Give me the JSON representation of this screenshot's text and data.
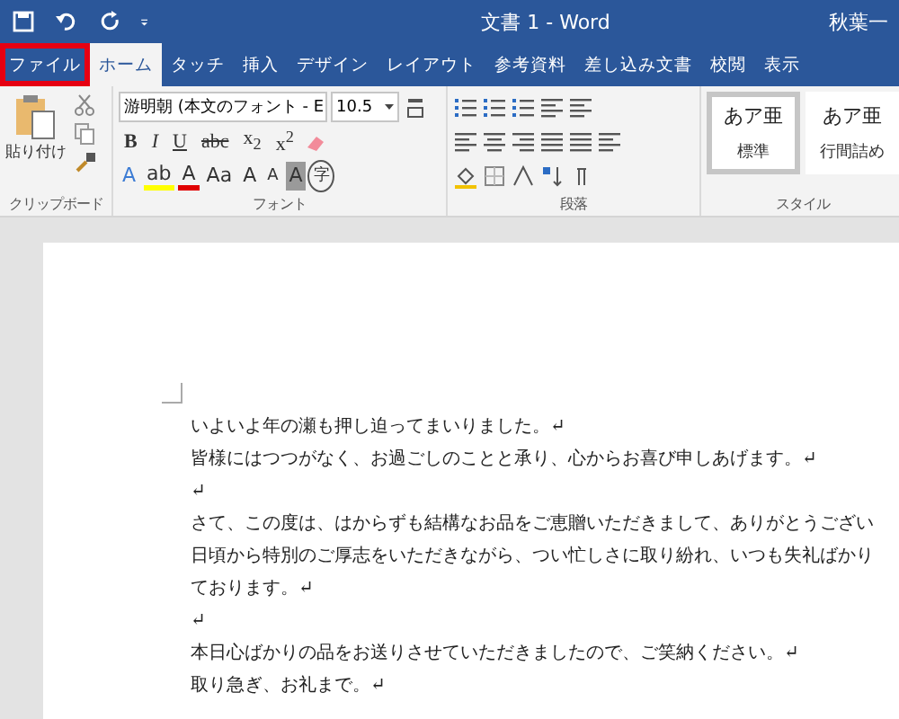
{
  "title_bar": {
    "title": "文書 1 - Word",
    "user": "秋葉一"
  },
  "tabs": [
    {
      "label": "ファイル",
      "selected": false,
      "highlighted": true
    },
    {
      "label": "ホーム",
      "selected": true,
      "highlighted": false
    },
    {
      "label": "タッチ",
      "selected": false,
      "highlighted": false
    },
    {
      "label": "挿入",
      "selected": false,
      "highlighted": false
    },
    {
      "label": "デザイン",
      "selected": false,
      "highlighted": false
    },
    {
      "label": "レイアウト",
      "selected": false,
      "highlighted": false
    },
    {
      "label": "参考資料",
      "selected": false,
      "highlighted": false
    },
    {
      "label": "差し込み文書",
      "selected": false,
      "highlighted": false
    },
    {
      "label": "校閲",
      "selected": false,
      "highlighted": false
    },
    {
      "label": "表示",
      "selected": false,
      "highlighted": false
    }
  ],
  "clipboard": {
    "paste_label": "貼り付け",
    "group_label": "クリップボード"
  },
  "font": {
    "font_name": "游明朝 (本文のフォント - E",
    "font_size": "10.5",
    "group_label": "フォント",
    "format_buttons": [
      {
        "label": "B",
        "kind": "bold"
      },
      {
        "label": "I",
        "kind": "italic"
      },
      {
        "label": "U",
        "kind": "underline"
      },
      {
        "label": "abc",
        "kind": "strike"
      },
      {
        "label": "x$_{2}$",
        "kind": "plain"
      },
      {
        "label": "x$^{2}$",
        "kind": "plain"
      }
    ],
    "effect_buttons": [
      {
        "label": "A",
        "kind": "outline"
      },
      {
        "label": "ab",
        "kind": "highlight"
      },
      {
        "label": "A",
        "kind": "fontcolor"
      },
      {
        "label": "Aa",
        "kind": "plain"
      },
      {
        "label": "A",
        "kind": "grow"
      },
      {
        "label": "A",
        "kind": "shrink"
      },
      {
        "label": "A",
        "kind": "shade"
      },
      {
        "label": "字",
        "kind": "circle"
      }
    ]
  },
  "paragraph": {
    "group_label": "段落"
  },
  "styles": {
    "group_label": "スタイル",
    "items": [
      {
        "preview": "あア亜",
        "name": "標準",
        "selected": true
      },
      {
        "preview": "あア亜",
        "name": "行間詰め",
        "selected": false
      }
    ]
  },
  "document": {
    "paragraphs": [
      "いよいよ年の瀬も押し迫ってまいりました。↵",
      "皆様にはつつがなく、お過ごしのことと承り、心からお喜び申しあげます。↵",
      "↵",
      "さて、この度は、はからずも結構なお品をご恵贈いただきまして、ありがとうござい",
      "日頃から特別のご厚志をいただきながら、つい忙しさに取り紛れ、いつも失礼ばかり",
      "ております。↵",
      "↵",
      "本日心ばかりの品をお送りさせていただきましたので、ご笑納ください。↵",
      "取り急ぎ、お礼まで。↵"
    ]
  }
}
